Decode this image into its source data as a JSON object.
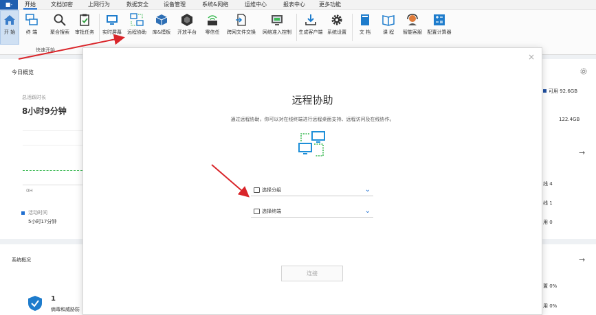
{
  "app_button": "■-",
  "menu": [
    "开始",
    "文档加密",
    "上网行为",
    "数据安全",
    "设备管理",
    "系统&网络",
    "运维中心",
    "报表中心",
    "更多功能"
  ],
  "ribbon": {
    "home": "开 始",
    "tools": [
      "终 端",
      "聚合搜索",
      "审批任务",
      "实时屏幕",
      "远程协助",
      "库&模板",
      "开放平台",
      "零信任",
      "跨网文件交换",
      "网络准入控制",
      "生成客户端",
      "系统设置",
      "文 档",
      "课 程",
      "智能客服",
      "配置计算器"
    ],
    "group_label": "快速开始"
  },
  "dashboard": {
    "today_title": "今日概览",
    "online_label": "总活跃时长",
    "online_value": "8小时9分钟",
    "axis_zero": "0H",
    "legend_label": "活动时间",
    "legend_value": "5小时17分钟",
    "sys_title": "系统概况",
    "sys_count": "1",
    "sys_count_label": "病毒和威胁防",
    "right_avail": "可用 92.6GB",
    "right_total": "122.4GB",
    "right_r1": "线 4",
    "right_r2": "线 1",
    "right_r3": "用 0",
    "right_r4": "置 0%",
    "right_r5": "用 0%"
  },
  "modal": {
    "close": "×",
    "title": "远程协助",
    "desc": "通过远程协助，你可以对在线终端进行远程桌面支持、远程访问及在线协作。",
    "select_group": "选择分组",
    "select_terminal": "选择终端",
    "connect": "连接"
  },
  "colors": {
    "accent": "#1f6fd0",
    "arrow": "#d9252a",
    "monitor": "#1e8fd8",
    "dashed": "#3cba54"
  }
}
